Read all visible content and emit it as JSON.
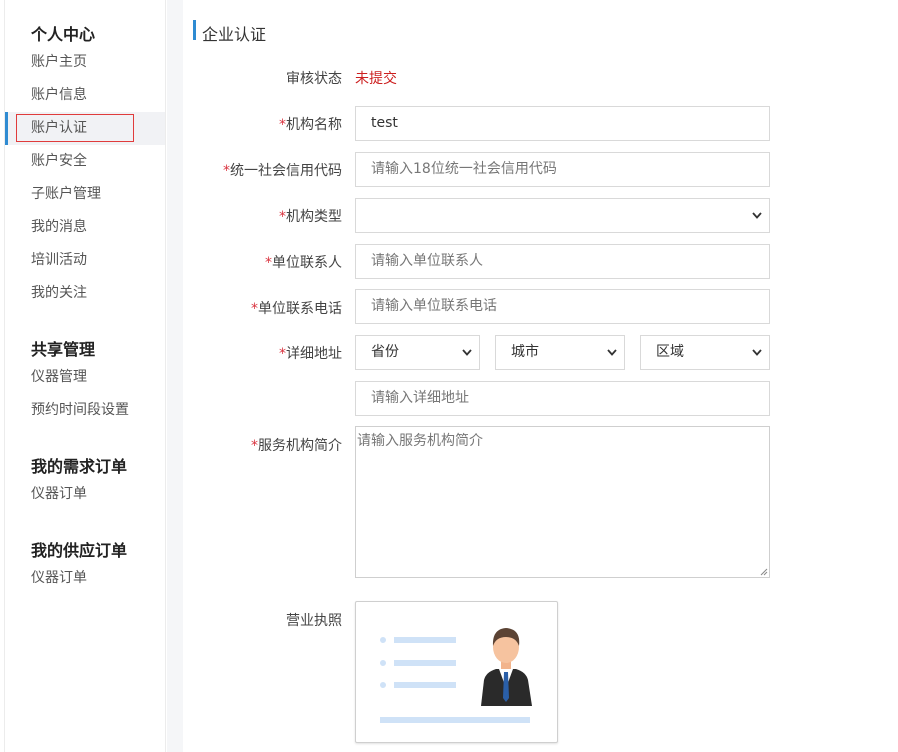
{
  "sidebar": {
    "sections": [
      {
        "title": "个人中心",
        "items": [
          "账户主页",
          "账户信息",
          "账户认证",
          "账户安全",
          "子账户管理",
          "我的消息",
          "培训活动",
          "我的关注"
        ]
      },
      {
        "title": "共享管理",
        "items": [
          "仪器管理",
          "预约时间段设置"
        ]
      },
      {
        "title": "我的需求订单",
        "items": [
          "仪器订单"
        ]
      },
      {
        "title": "我的供应订单",
        "items": [
          "仪器订单"
        ]
      }
    ],
    "active_item": "账户认证"
  },
  "page": {
    "title": "企业认证",
    "status_label": "审核状态",
    "status_value": "未提交",
    "required_mark": "*"
  },
  "form": {
    "org_name": {
      "label": "机构名称",
      "value": "test"
    },
    "credit_code": {
      "label": "统一社会信用代码",
      "placeholder": "请输入18位统一社会信用代码"
    },
    "org_type": {
      "label": "机构类型",
      "value": ""
    },
    "contact": {
      "label": "单位联系人",
      "placeholder": "请输入单位联系人"
    },
    "phone": {
      "label": "单位联系电话",
      "placeholder": "请输入单位联系电话"
    },
    "address": {
      "label": "详细地址",
      "province": "省份",
      "city": "城市",
      "district": "区域",
      "detail_placeholder": "请输入详细地址"
    },
    "intro": {
      "label": "服务机构简介",
      "placeholder": "请输入服务机构简介"
    },
    "license": {
      "label": "营业执照"
    }
  },
  "colors": {
    "accent": "#2f8bd2",
    "required": "#d9333f",
    "status": "#cc1f1f",
    "highlight_box": "#e03c3c"
  }
}
